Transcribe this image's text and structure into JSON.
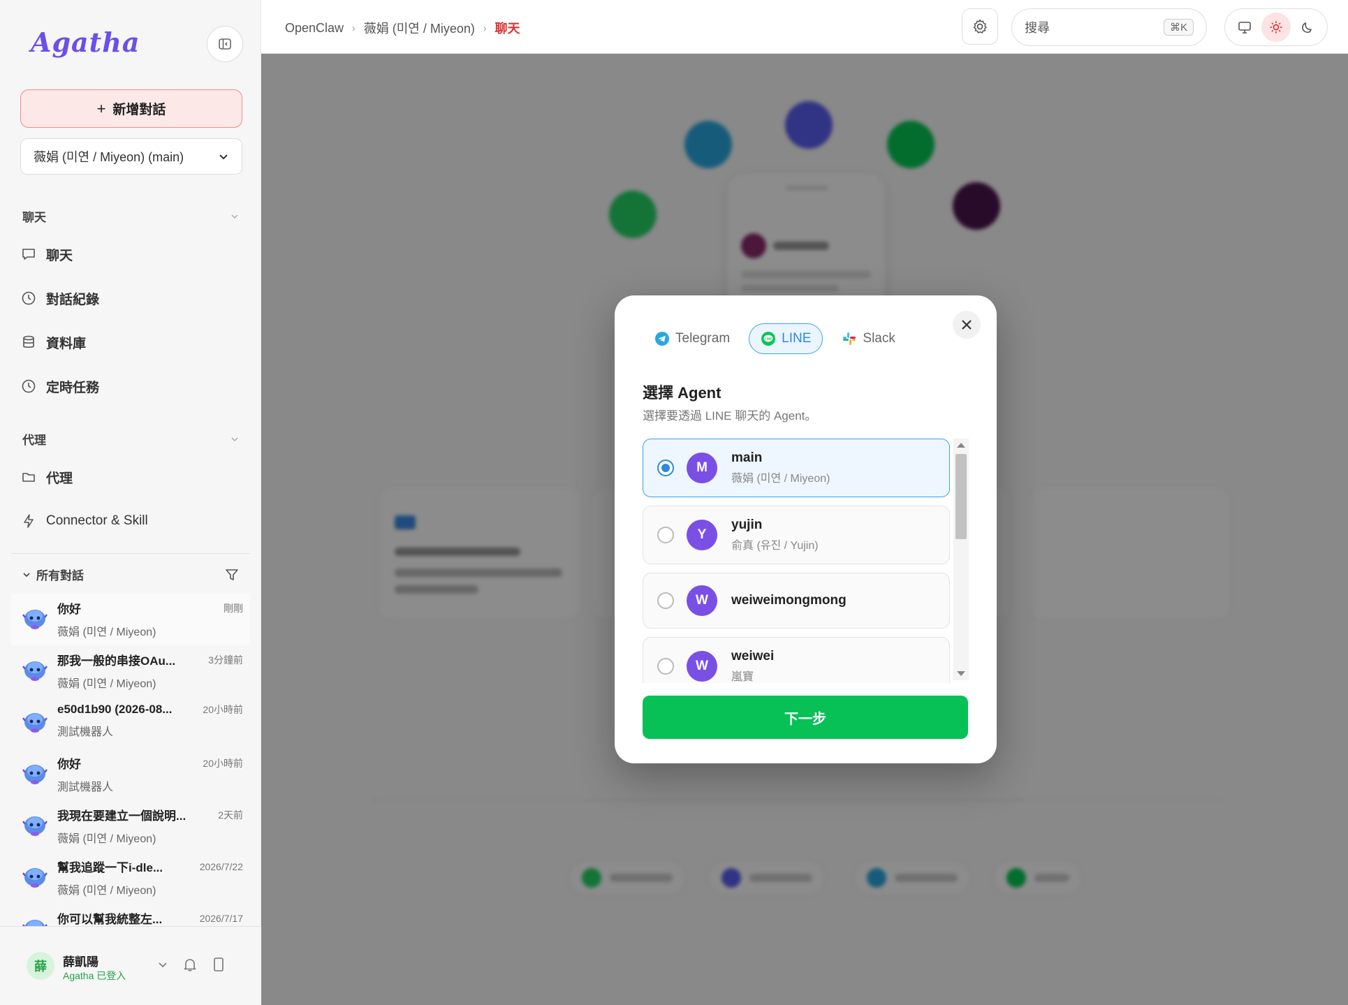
{
  "sidebar": {
    "logo_text": "Agatha",
    "new_chat_label": "新增對話",
    "agent_select_value": "薇娟 (미연 / Miyeon) (main)",
    "section_chat": "聊天",
    "nav_chat": [
      {
        "label": "聊天",
        "icon": "chat-bubble-icon"
      },
      {
        "label": "對話紀錄",
        "icon": "clock-icon"
      },
      {
        "label": "資料庫",
        "icon": "database-icon"
      },
      {
        "label": "定時任務",
        "icon": "clock-icon"
      }
    ],
    "section_agent": "代理",
    "nav_agent": [
      {
        "label": "代理",
        "icon": "folder-icon"
      },
      {
        "label": "Connector & Skill",
        "icon": "lightning-icon"
      }
    ],
    "conversations_header": "所有對話",
    "conversations": [
      {
        "title": "你好",
        "time": "剛剛",
        "sub": "薇娟 (미연 / Miyeon)"
      },
      {
        "title": "那我一般的串接OAu...",
        "time": "3分鐘前",
        "sub": "薇娟 (미연 / Miyeon)"
      },
      {
        "title": "e50d1b90 (2026-08...",
        "time": "20小時前",
        "sub": "測試機器人"
      },
      {
        "title": "你好",
        "time": "20小時前",
        "sub": "測試機器人"
      },
      {
        "title": "我現在要建立一個說明...",
        "time": "2天前",
        "sub": "薇娟 (미연 / Miyeon)"
      },
      {
        "title": "幫我追蹤一下i-dle...",
        "time": "2026/7/22",
        "sub": "薇娟 (미연 / Miyeon)"
      },
      {
        "title": "你可以幫我統整左...",
        "time": "2026/7/17",
        "sub": ""
      }
    ],
    "user": {
      "avatar_char": "薛",
      "name": "薛凱陽",
      "status": "Agatha 已登入"
    }
  },
  "topbar": {
    "breadcrumb": [
      "OpenClaw",
      "薇娟 (미연 / Miyeon)",
      "聊天"
    ],
    "search_placeholder": "搜尋",
    "search_shortcut": "⌘K"
  },
  "modal": {
    "tabs": [
      {
        "label": "Telegram",
        "icon": "telegram-icon",
        "active": false
      },
      {
        "label": "LINE",
        "icon": "line-icon",
        "active": true
      },
      {
        "label": "Slack",
        "icon": "slack-icon",
        "active": false
      }
    ],
    "title": "選擇 Agent",
    "subtitle": "選擇要透過 LINE 聊天的 Agent。",
    "agents": [
      {
        "initial": "M",
        "name": "main",
        "desc": "薇娟 (미연 / Miyeon)",
        "selected": true
      },
      {
        "initial": "Y",
        "name": "yujin",
        "desc": "俞真 (유진 / Yujin)",
        "selected": false
      },
      {
        "initial": "W",
        "name": "weiweimongmong",
        "desc": "",
        "selected": false
      },
      {
        "initial": "W",
        "name": "weiwei",
        "desc": "嵐寶",
        "selected": false
      }
    ],
    "next_label": "下一步"
  },
  "colors": {
    "accent_red": "#d83434",
    "line_green": "#07c156",
    "selected_blue": "#2a8ae0",
    "agent_purple": "#7a4fe6"
  }
}
